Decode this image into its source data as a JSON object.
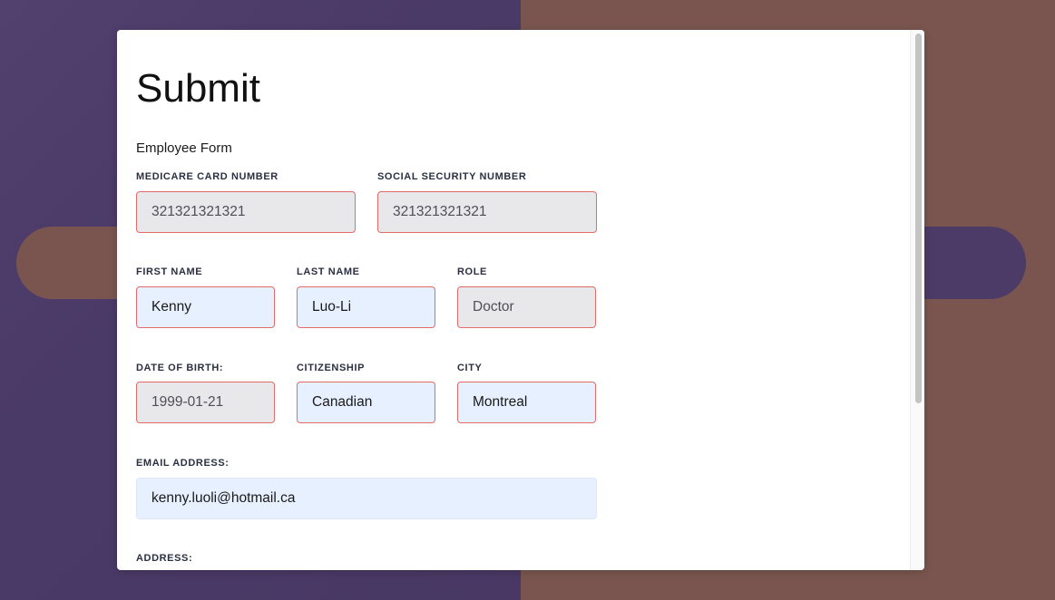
{
  "form": {
    "title": "Submit",
    "subtitle": "Employee Form",
    "labels": {
      "medicare": "MEDICARE CARD NUMBER",
      "ssn": "SOCIAL SECURITY NUMBER",
      "first_name": "FIRST NAME",
      "last_name": "LAST NAME",
      "role": "ROLE",
      "dob": "DATE OF BIRTH:",
      "citizenship": "CITIZENSHIP",
      "city": "CITY",
      "email": "EMAIL ADDRESS:",
      "address": "ADDRESS:"
    },
    "values": {
      "medicare": "321321321321",
      "ssn": "321321321321",
      "first_name": "Kenny",
      "last_name": "Luo-Li",
      "role": "Doctor",
      "dob": "1999-01-21",
      "citizenship": "Canadian",
      "city": "Montreal",
      "email": "kenny.luoli@hotmail.ca"
    }
  },
  "colors": {
    "background_left": "#4b3b66",
    "background_right": "#7a554f",
    "invalid_border": "#e46a6a",
    "readonly_fill": "#e8e8eb",
    "editable_fill": "#e7f0fe"
  }
}
